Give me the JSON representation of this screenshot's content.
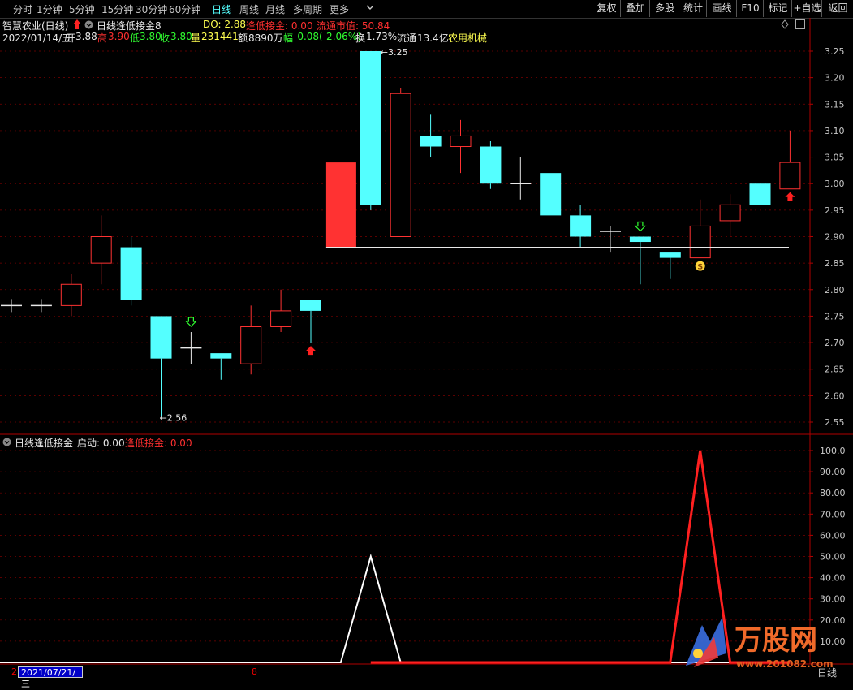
{
  "toolbar": {
    "left": [
      {
        "label": "分时",
        "active": false
      },
      {
        "label": "1分钟",
        "active": false
      },
      {
        "label": "5分钟",
        "active": false
      },
      {
        "label": "15分钟",
        "active": false
      },
      {
        "label": "30分钟",
        "active": false
      },
      {
        "label": "60分钟",
        "active": false
      },
      {
        "label": "日线",
        "active": true
      },
      {
        "label": "周线",
        "active": false
      },
      {
        "label": "月线",
        "active": false
      },
      {
        "label": "多周期",
        "active": false
      },
      {
        "label": "更多",
        "active": false
      }
    ],
    "right": [
      "复权",
      "叠加",
      "多股",
      "统计",
      "画线",
      "F10",
      "标记",
      "+自选",
      "返回"
    ]
  },
  "info_line1": {
    "stock": "智慧农业(日线)",
    "indicator": "日线逢低接金8",
    "do_label": "DO: 2.88",
    "fdjj_label": "逢低接金: 0.00",
    "ltsz_label": "流通市值: 50.84"
  },
  "info_line2": {
    "date": "2022/01/14/五",
    "open_label": "开",
    "open": "3.88",
    "high_label": "高",
    "high": "3.90",
    "low_label": "低",
    "low": "3.80",
    "close_label": "收",
    "close": "3.80",
    "vol_label": "量",
    "vol": "231441",
    "amount_label": "额",
    "amount": "8890万",
    "change_label": "幅",
    "change": "-0.08(-2.06%)",
    "turnover_label": "换",
    "turnover": "1.73%",
    "float_label": "流通",
    "float": "13.4亿",
    "sector": "农用机械"
  },
  "sub_legend": {
    "name": "日线逢低接金",
    "start_label": "启动: 0.00",
    "fdjj_label": "逢低接金: 0.00"
  },
  "chart_data": [
    {
      "type": "candlestick",
      "ylim": [
        2.52,
        3.28
      ],
      "y_ticks": [
        "3.25",
        "3.20",
        "3.15",
        "3.10",
        "3.05",
        "3.00",
        "2.95",
        "2.90",
        "2.85",
        "2.80",
        "2.75",
        "2.70",
        "2.65",
        "2.60",
        "2.55"
      ],
      "candles": [
        {
          "o": 2.77,
          "h": 2.77,
          "l": 2.77,
          "c": 2.77
        },
        {
          "o": 2.77,
          "h": 2.77,
          "l": 2.77,
          "c": 2.77
        },
        {
          "o": 2.77,
          "h": 2.83,
          "l": 2.75,
          "c": 2.81
        },
        {
          "o": 2.85,
          "h": 2.94,
          "l": 2.81,
          "c": 2.9
        },
        {
          "o": 2.88,
          "h": 2.9,
          "l": 2.77,
          "c": 2.78
        },
        {
          "o": 2.75,
          "h": 2.75,
          "l": 2.56,
          "c": 2.67
        },
        {
          "o": 2.69,
          "h": 2.72,
          "l": 2.66,
          "c": 2.69
        },
        {
          "o": 2.68,
          "h": 2.68,
          "l": 2.63,
          "c": 2.67
        },
        {
          "o": 2.66,
          "h": 2.77,
          "l": 2.64,
          "c": 2.73
        },
        {
          "o": 2.73,
          "h": 2.8,
          "l": 2.72,
          "c": 2.76
        },
        {
          "o": 2.78,
          "h": 2.78,
          "l": 2.7,
          "c": 2.76
        },
        {
          "o": 2.88,
          "h": 3.04,
          "l": 2.88,
          "c": 3.04
        },
        {
          "o": 3.25,
          "h": 3.25,
          "l": 2.95,
          "c": 2.96
        },
        {
          "o": 2.9,
          "h": 3.18,
          "l": 2.9,
          "c": 3.17
        },
        {
          "o": 3.09,
          "h": 3.13,
          "l": 3.05,
          "c": 3.07
        },
        {
          "o": 3.07,
          "h": 3.12,
          "l": 3.02,
          "c": 3.09
        },
        {
          "o": 3.07,
          "h": 3.08,
          "l": 2.99,
          "c": 3.0
        },
        {
          "o": 3.0,
          "h": 3.05,
          "l": 2.97,
          "c": 3.0
        },
        {
          "o": 3.02,
          "h": 3.02,
          "l": 2.94,
          "c": 2.94
        },
        {
          "o": 2.94,
          "h": 2.96,
          "l": 2.88,
          "c": 2.9
        },
        {
          "o": 2.91,
          "h": 2.92,
          "l": 2.87,
          "c": 2.91
        },
        {
          "o": 2.9,
          "h": 2.9,
          "l": 2.81,
          "c": 2.89
        },
        {
          "o": 2.87,
          "h": 2.87,
          "l": 2.82,
          "c": 2.86
        },
        {
          "o": 2.86,
          "h": 2.97,
          "l": 2.86,
          "c": 2.92
        },
        {
          "o": 2.93,
          "h": 2.98,
          "l": 2.9,
          "c": 2.96
        },
        {
          "o": 3.0,
          "h": 3.0,
          "l": 2.93,
          "c": 2.96
        },
        {
          "o": 2.99,
          "h": 3.1,
          "l": 2.99,
          "c": 3.04
        }
      ],
      "support_level": 2.88,
      "annotations": {
        "max_label": "3.25",
        "min_label": "2.56"
      },
      "signals": [
        {
          "index": 6,
          "kind": "down-arrow"
        },
        {
          "index": 10,
          "kind": "up-arrow"
        },
        {
          "index": 21,
          "kind": "down-arrow"
        },
        {
          "index": 23,
          "kind": "money-bag"
        },
        {
          "index": 26,
          "kind": "up-arrow"
        }
      ]
    },
    {
      "type": "line",
      "ylim": [
        0,
        105
      ],
      "y_ticks": [
        "100.0",
        "90.00",
        "80.00",
        "70.00",
        "60.00",
        "50.00",
        "40.00",
        "30.00",
        "20.00",
        "10.00"
      ],
      "series": [
        {
          "color": "#ffffff",
          "values": [
            0,
            0,
            0,
            0,
            0,
            0,
            0,
            0,
            0,
            0,
            0,
            0,
            50,
            0,
            0,
            0,
            0,
            0,
            0,
            0,
            0,
            0,
            0,
            0,
            0,
            0,
            0
          ]
        },
        {
          "color": "#ff2020",
          "values": [
            null,
            null,
            null,
            null,
            null,
            null,
            null,
            null,
            null,
            null,
            null,
            null,
            0,
            0,
            0,
            0,
            0,
            0,
            0,
            0,
            0,
            0,
            0,
            100,
            0,
            0,
            0
          ]
        }
      ]
    }
  ],
  "x_axis": {
    "start_date": "2021/07/21/三",
    "left_mark": "2",
    "mid_mark": "8",
    "period": "日线"
  },
  "watermark": {
    "brand": "万股网",
    "url": "www.201082.com"
  },
  "colors": {
    "up": "#ff3232",
    "down": "#54ffff",
    "axis": "#b00000",
    "grid": "#7a0000"
  }
}
